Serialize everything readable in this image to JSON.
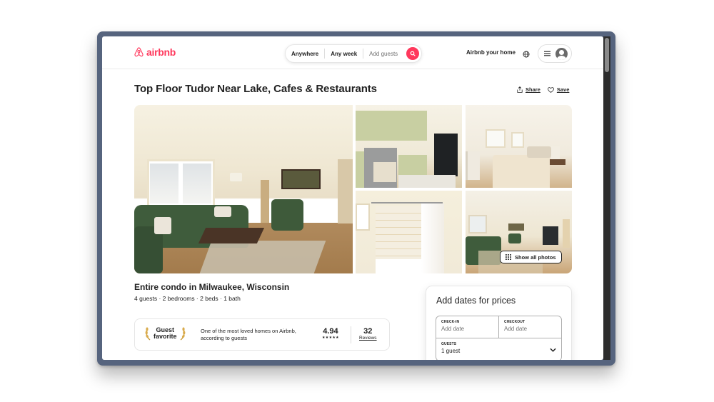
{
  "header": {
    "brand": "airbnb",
    "search": {
      "location": "Anywhere",
      "dates": "Any week",
      "guests_placeholder": "Add guests"
    },
    "host_link": "Airbnb your home",
    "icons": {
      "logo": "airbnb-logo-icon",
      "search": "search-icon",
      "globe": "globe-icon",
      "menu": "hamburger-menu-icon",
      "avatar": "user-avatar-icon"
    }
  },
  "listing": {
    "title": "Top Floor Tudor Near Lake, Cafes & Restaurants",
    "actions": {
      "share": "Share",
      "save": "Save"
    },
    "photos": {
      "items": [
        {
          "subject": "living room with green sofa"
        },
        {
          "subject": "kitchen"
        },
        {
          "subject": "bedroom"
        },
        {
          "subject": "bathroom"
        },
        {
          "subject": "living room with TV"
        }
      ],
      "show_all_label": "Show all photos"
    },
    "subtitle": "Entire condo in Milwaukee, Wisconsin",
    "specs": "4 guests · 2 bedrooms · 2 beds · 1 bath",
    "guest_favorite": {
      "badge_line1": "Guest",
      "badge_line2": "favorite",
      "description": "One of the most loved homes on Airbnb, according to guests",
      "rating": "4.94",
      "stars": "★★★★★",
      "reviews_count": "32",
      "reviews_label": "Reviews"
    }
  },
  "booking": {
    "title": "Add dates for prices",
    "checkin_label": "CHECK-IN",
    "checkin_value": "Add date",
    "checkout_label": "CHECKOUT",
    "checkout_value": "Add date",
    "guests_label": "GUESTS",
    "guests_value": "1 guest"
  },
  "colors": {
    "brand": "#ff385c",
    "text": "#222222",
    "muted": "#717171",
    "frame": "#56647e"
  }
}
